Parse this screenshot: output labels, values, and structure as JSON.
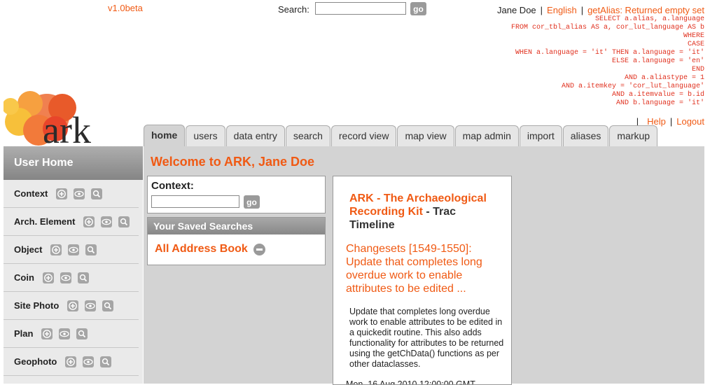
{
  "header": {
    "version": "v1.0beta",
    "search_label": "Search:",
    "search_value": "",
    "go_label": "go",
    "user_name": "Jane Doe",
    "language": "English",
    "alias_msg": "getAlias: Returned empty set",
    "sep": "|",
    "sql": "SELECT a.alias, a.language\nFROM cor_tbl_alias AS a, cor_lut_language AS b\nWHERE\nCASE\nWHEN a.language = 'it' THEN a.language = 'it'\nELSE a.language = 'en'\nEND\nAND a.aliastype = 1\nAND a.itemkey = 'cor_lut_language'\nAND a.itemvalue = b.id\nAND b.language = 'it'",
    "help_label": "Help",
    "logout_label": "Logout",
    "logo_text": "ark"
  },
  "tabs": [
    {
      "label": "home"
    },
    {
      "label": "users"
    },
    {
      "label": "data entry"
    },
    {
      "label": "search"
    },
    {
      "label": "record view"
    },
    {
      "label": "map view"
    },
    {
      "label": "map admin"
    },
    {
      "label": "import"
    },
    {
      "label": "aliases"
    },
    {
      "label": "markup"
    }
  ],
  "sidebar": {
    "title": "User Home",
    "items": [
      {
        "label": "Context"
      },
      {
        "label": "Arch. Element"
      },
      {
        "label": "Object"
      },
      {
        "label": "Coin"
      },
      {
        "label": "Site Photo"
      },
      {
        "label": "Plan"
      },
      {
        "label": "Geophoto"
      }
    ]
  },
  "main": {
    "welcome": "Welcome to ARK, Jane Doe",
    "context_label": "Context:",
    "context_value": "",
    "go_label": "go",
    "saved_title": "Your Saved Searches",
    "saved_item": "All Address Book",
    "trac_link": "ARK - The Archaeological Recording Kit",
    "trac_suffix": " - Trac Timeline",
    "changeset": "Changesets [1549-1550]: Update that completes long overdue work to enable attributes to be edited ...",
    "description": "Update that completes long overdue work to enable attributes to be edited in a quickedit routine. This also adds functionality for attributes to be returned using the getChData() functions as per other dataclasses.",
    "date": "Mon, 16 Aug 2010 12:00:00 GMT"
  },
  "colors": {
    "accent": "#f05a14",
    "sql": "#e0301e",
    "panel": "#d3d3d3"
  }
}
